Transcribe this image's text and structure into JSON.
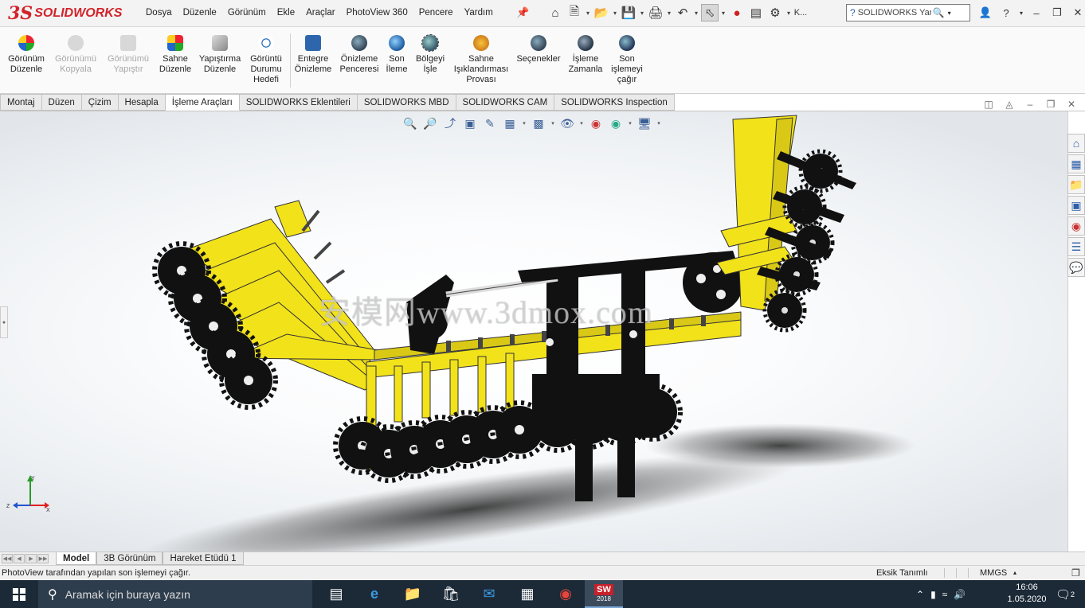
{
  "app": {
    "brand": "SOLIDWORKS",
    "colors": {
      "brand_red": "#d2232a",
      "machine_yellow": "#f2e21a",
      "taskbar": "#1c2a38"
    }
  },
  "menu": {
    "items": [
      "Dosya",
      "Düzenle",
      "Görünüm",
      "Ekle",
      "Araçlar",
      "PhotoView 360",
      "Pencere",
      "Yardım"
    ]
  },
  "quick_access": {
    "icons": [
      "home-icon",
      "new-document-icon",
      "open-icon",
      "save-icon",
      "print-icon",
      "undo-icon",
      "select-icon",
      "rebuild-icon",
      "file-properties-icon",
      "options-icon"
    ],
    "truncated_label": "K..."
  },
  "search": {
    "placeholder": "SOLIDWORKS Yardımında Ara",
    "value": "SOLIDWORKS Yarc"
  },
  "ribbon": {
    "buttons": [
      {
        "label": "Görünüm\nDüzenle",
        "enabled": true,
        "icon": "appearance-icon"
      },
      {
        "label": "Görünümü\nKopyala",
        "enabled": false,
        "icon": "copy-appearance-icon"
      },
      {
        "label": "Görünümü\nYapıştır",
        "enabled": false,
        "icon": "paste-appearance-icon"
      },
      {
        "label": "Sahne\nDüzenle",
        "enabled": true,
        "icon": "scene-icon"
      },
      {
        "label": "Yapıştırma\nDüzenle",
        "enabled": true,
        "icon": "decal-icon"
      },
      {
        "label": "Görüntü\nDurumu\nHedefi",
        "enabled": true,
        "icon": "display-state-icon"
      },
      {
        "label": "Entegre\nÖnizleme",
        "enabled": true,
        "icon": "integrated-preview-icon"
      },
      {
        "label": "Önizleme\nPenceresi",
        "enabled": true,
        "icon": "preview-window-icon"
      },
      {
        "label": "Son\nİleme",
        "enabled": true,
        "icon": "final-render-icon"
      },
      {
        "label": "Bölgeyi\nİşle",
        "enabled": true,
        "icon": "render-region-icon"
      },
      {
        "label": "Sahne\nIşıklandırması\nProvası",
        "enabled": true,
        "icon": "scene-illumination-icon"
      },
      {
        "label": "Seçenekler",
        "enabled": true,
        "icon": "options-icon"
      },
      {
        "label": "İşleme\nZamanla",
        "enabled": true,
        "icon": "schedule-render-icon"
      },
      {
        "label": "Son\nişlemeyi\nçağır",
        "enabled": true,
        "icon": "recall-render-icon"
      }
    ]
  },
  "tabs": {
    "items": [
      "Montaj",
      "Düzen",
      "Çizim",
      "Hesapla",
      "İşleme Araçları",
      "SOLIDWORKS Eklentileri",
      "SOLIDWORKS MBD",
      "SOLIDWORKS CAM",
      "SOLIDWORKS Inspection"
    ],
    "active": "İşleme Araçları"
  },
  "graphics": {
    "watermark": "安模网www.3dmox.com",
    "triad": {
      "x": "X",
      "y": "Y",
      "z": "Z"
    }
  },
  "bottom_tabs": {
    "items": [
      "Model",
      "3B Görünüm",
      "Hareket Etüdü 1"
    ],
    "active": "Model"
  },
  "status": {
    "message": "PhotoView tarafından yapılan son işlemeyi çağır.",
    "definition": "Eksik Tanımlı",
    "units": "MMGS"
  },
  "taskbar": {
    "search_placeholder": "Aramak için buraya yazın",
    "time": "16:06",
    "date": "1.05.2020",
    "notifications": "2",
    "sw_badge": "2018"
  }
}
